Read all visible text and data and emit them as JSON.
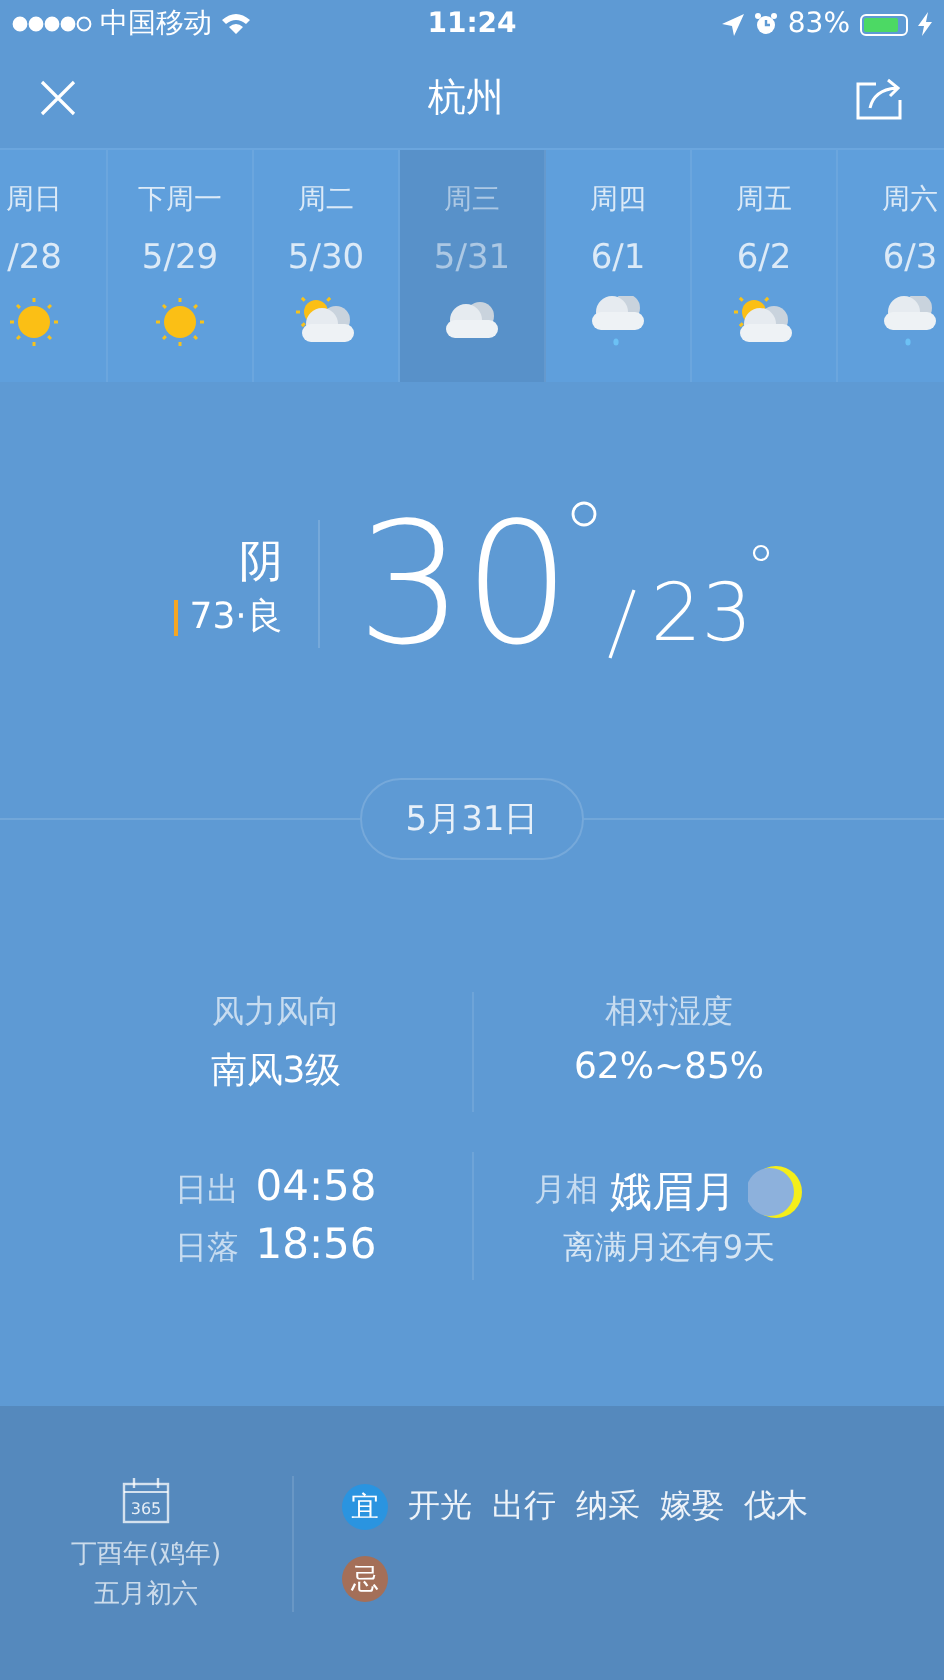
{
  "status_bar": {
    "carrier": "中国移动",
    "time": "11:24",
    "battery": "83%"
  },
  "header": {
    "title": "杭州"
  },
  "forecast": [
    {
      "day": "周日",
      "date": "/28",
      "kind": "sunny",
      "selected": false
    },
    {
      "day": "下周一",
      "date": "5/29",
      "kind": "sunny",
      "selected": false
    },
    {
      "day": "周二",
      "date": "5/30",
      "kind": "partly",
      "selected": false
    },
    {
      "day": "周三",
      "date": "5/31",
      "kind": "cloudy",
      "selected": true
    },
    {
      "day": "周四",
      "date": "6/1",
      "kind": "rain",
      "selected": false
    },
    {
      "day": "周五",
      "date": "6/2",
      "kind": "partly",
      "selected": false
    },
    {
      "day": "周六",
      "date": "6/3",
      "kind": "rain",
      "selected": false
    }
  ],
  "current": {
    "condition": "阴",
    "aqi": "73·良",
    "high": "30",
    "low": "23"
  },
  "date_pill": "5月31日",
  "details": {
    "wind_label": "风力风向",
    "wind": "南风3级",
    "humidity_label": "相对湿度",
    "humidity": "62%~85%",
    "sunrise_label": "日出",
    "sunrise": "04:58",
    "sunset_label": "日落",
    "sunset": "18:56",
    "moon_label": "月相",
    "moon_phase": "娥眉月",
    "moon_note": "离满月还有9天"
  },
  "almanac": {
    "year": "丁酉年(鸡年)",
    "lunar_date": "五月初六",
    "calendar_icon_text": "365",
    "rows": [
      {
        "tag": "宜",
        "color": "#2a94e0",
        "items": [
          "开光",
          "出行",
          "纳采",
          "嫁娶",
          "伐木"
        ]
      },
      {
        "tag": "忌",
        "color": "#a46f58",
        "items": []
      }
    ]
  }
}
